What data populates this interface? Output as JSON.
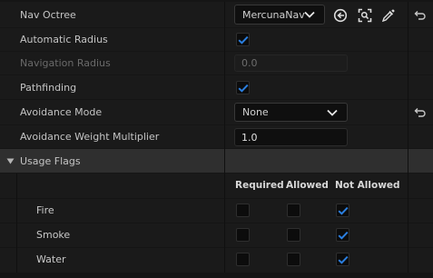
{
  "properties": {
    "nav_octree": {
      "label": "Nav Octree",
      "value": "MercunaNav"
    },
    "automatic_radius": {
      "label": "Automatic Radius",
      "checked": true
    },
    "navigation_radius": {
      "label": "Navigation Radius",
      "value": "0.0",
      "enabled": false
    },
    "pathfinding": {
      "label": "Pathfinding",
      "checked": true
    },
    "avoidance_mode": {
      "label": "Avoidance Mode",
      "value": "None"
    },
    "avoidance_weight_multiplier": {
      "label": "Avoidance Weight Multiplier",
      "value": "1.0"
    }
  },
  "usage_flags": {
    "label": "Usage Flags",
    "columns": [
      "Required",
      "Allowed",
      "Not Allowed"
    ],
    "rows": [
      {
        "name": "Fire",
        "required": false,
        "allowed": false,
        "not_allowed": true
      },
      {
        "name": "Smoke",
        "required": false,
        "allowed": false,
        "not_allowed": true
      },
      {
        "name": "Water",
        "required": false,
        "allowed": false,
        "not_allowed": true
      }
    ]
  },
  "icons": {
    "browse": "arrow-left-circle-icon",
    "find": "find-in-content-icon",
    "pick": "eyedropper-icon",
    "reset": "reset-to-default-icon",
    "expand": "triangle-down-icon",
    "check": "checkmark-icon"
  },
  "colors": {
    "accent": "#2b7fe0",
    "panel": "#1a1a1a",
    "header": "#2f2f2f"
  }
}
